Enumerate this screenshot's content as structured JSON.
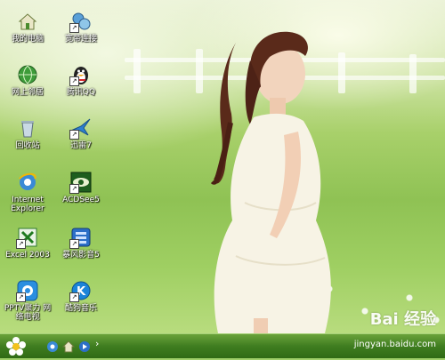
{
  "desktop": {
    "icons": [
      {
        "label": "我的电脑",
        "icon": "my-computer-icon",
        "shortcut": false
      },
      {
        "label": "宽带连接",
        "icon": "broadband-connection-icon",
        "shortcut": true
      },
      {
        "label": "网上邻居",
        "icon": "network-places-icon",
        "shortcut": false
      },
      {
        "label": "腾讯QQ",
        "icon": "qq-penguin-icon",
        "shortcut": true
      },
      {
        "label": "回收站",
        "icon": "recycle-bin-icon",
        "shortcut": false
      },
      {
        "label": "迅雷7",
        "icon": "thunder-bird-icon",
        "shortcut": true
      },
      {
        "label": "Internet Explorer",
        "icon": "internet-explorer-icon",
        "shortcut": false
      },
      {
        "label": "ACDSee5",
        "icon": "acdsee-eye-icon",
        "shortcut": true
      },
      {
        "label": "Excel 2003",
        "icon": "excel-icon",
        "shortcut": true
      },
      {
        "label": "暴风影音5",
        "icon": "baofeng-player-icon",
        "shortcut": true
      },
      {
        "label": "PPTV聚力 网络电视",
        "icon": "pptv-icon",
        "shortcut": true
      },
      {
        "label": "酷狗音乐",
        "icon": "kugou-music-icon",
        "shortcut": true
      }
    ]
  },
  "taskbar": {
    "start_icon": "flower-start-icon",
    "quick_launch": [
      "internet-explorer-icon",
      "show-desktop-icon",
      "media-player-icon"
    ],
    "more": "›"
  },
  "watermark": {
    "logo": "Bai 经验",
    "url": "jingyan.baidu.com"
  },
  "colors": {
    "taskbar": "#3f7d20",
    "grass": "#9fcf62",
    "dress": "#f6f3e6",
    "hair": "#5a2a1a"
  }
}
